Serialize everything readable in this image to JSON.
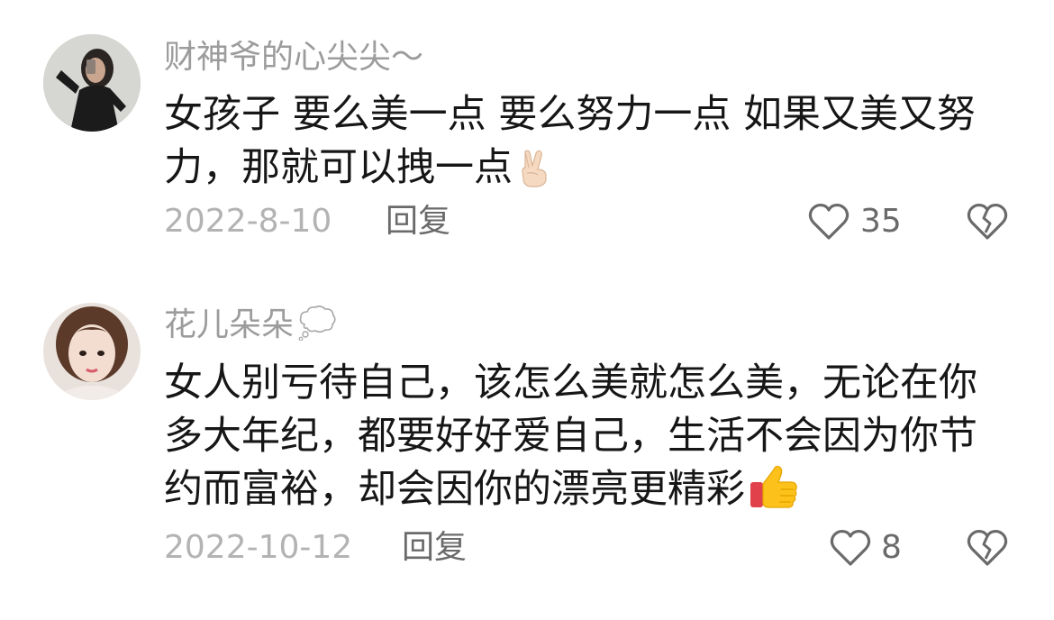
{
  "comments": [
    {
      "username": "财神爷的心尖尖～",
      "text": "女孩子 要么美一点 要么努力一点 如果又美又努力，那就可以拽一点",
      "emoji": "victory-hand-icon",
      "date": "2022-8-10",
      "reply_label": "回复",
      "like_count": "35"
    },
    {
      "username": "花儿朵朵",
      "username_emoji": "thought-balloon-icon",
      "text": "女人别亏待自己，该怎么美就怎么美，无论在你多大年纪，都要好好爱自己，生活不会因为你节约而富裕，却会因你的漂亮更精彩",
      "emoji": "thumbs-up-icon",
      "date": "2022-10-12",
      "reply_label": "回复",
      "like_count": "8"
    }
  ],
  "colors": {
    "username": "#9c9c9c",
    "text": "#161616",
    "date": "#b3b3b3",
    "action": "#6a6a6a",
    "icon_stroke": "#6a6a6a"
  }
}
